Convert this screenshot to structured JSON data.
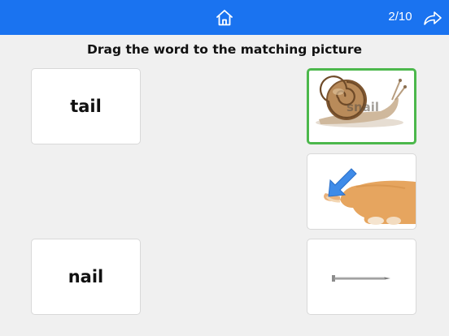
{
  "header": {
    "home_icon": "home-icon",
    "progress": "2/10",
    "next_icon": "share-forward-icon",
    "color": "#1a73f0"
  },
  "instruction": "Drag the word to the matching picture",
  "words": [
    {
      "label": "tail"
    },
    {
      "label": "nail"
    }
  ],
  "pictures": [
    {
      "subject": "snail",
      "label": "snail",
      "matched": true,
      "match_color": "#4cb84c"
    },
    {
      "subject": "dog-tail-with-arrow",
      "matched": false
    },
    {
      "subject": "nail",
      "matched": false
    }
  ]
}
